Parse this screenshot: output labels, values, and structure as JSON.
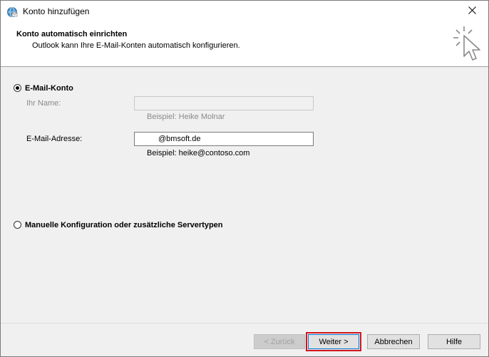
{
  "window": {
    "title": "Konto hinzufügen",
    "icons": {
      "app": "globe-mail-icon",
      "close": "close-icon",
      "wizard": "cursor-click-icon"
    }
  },
  "header": {
    "title": "Konto automatisch einrichten",
    "subtitle": "Outlook kann Ihre E-Mail-Konten automatisch konfigurieren."
  },
  "email_option": {
    "label": "E-Mail-Konto",
    "selected": true,
    "name_label": "Ihr Name:",
    "name_value": "",
    "name_hint": "Beispiel: Heike Molnar",
    "email_label": "E-Mail-Adresse:",
    "email_value": "@bmsoft.de",
    "email_hint": "Beispiel: heike@contoso.com"
  },
  "manual_option": {
    "label": "Manuelle Konfiguration oder zusätzliche Servertypen",
    "selected": false
  },
  "buttons": {
    "back": "< Zurück",
    "next": "Weiter >",
    "cancel": "Abbrechen",
    "help": "Hilfe"
  },
  "colors": {
    "highlight_outline": "#d0161c",
    "window_bg": "#f0f0f0"
  }
}
